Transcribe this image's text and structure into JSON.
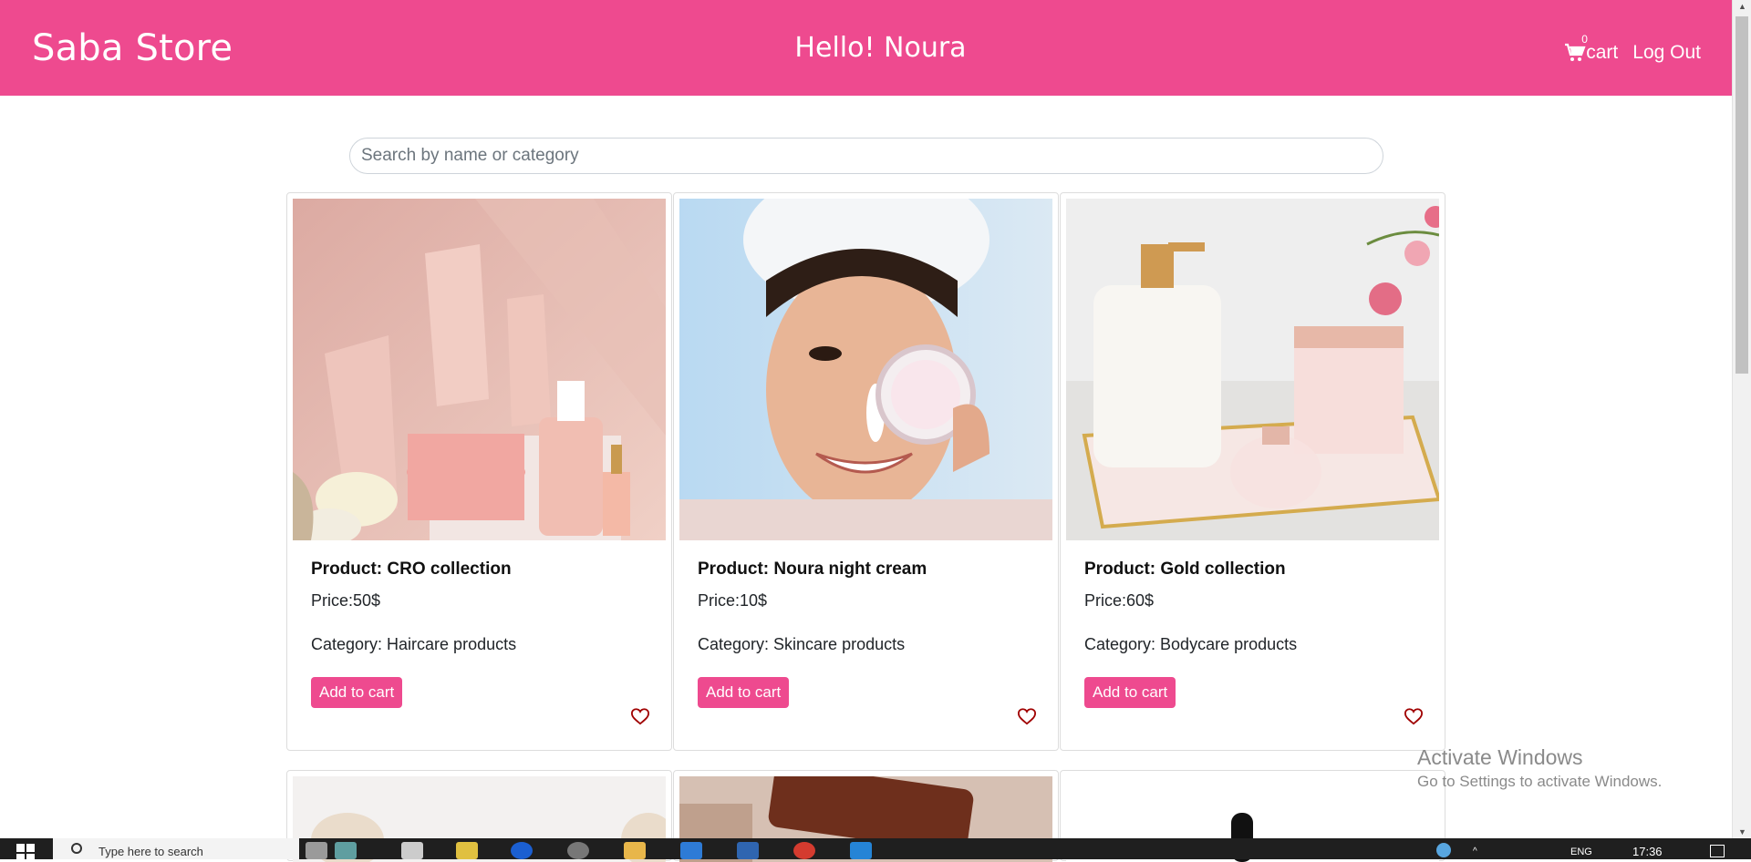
{
  "navbar": {
    "brand": "Saba Store",
    "greeting": "Hello! Noura",
    "cart_count": "0",
    "cart_label": "cart",
    "logout_label": "Log Out"
  },
  "search": {
    "placeholder": "Search by name or category"
  },
  "products": [
    {
      "title": "Product: CRO collection",
      "price": "Price:50$",
      "category": "Category: Haircare products",
      "button": "Add to cart"
    },
    {
      "title": "Product: Noura night cream",
      "price": "Price:10$",
      "category": "Category: Skincare products",
      "button": "Add to cart"
    },
    {
      "title": "Product: Gold collection",
      "price": "Price:60$",
      "category": "Category: Bodycare products",
      "button": "Add to cart"
    }
  ],
  "watermark": {
    "title": "Activate Windows",
    "subtitle": "Go to Settings to activate Windows."
  },
  "taskbar": {
    "search_text": "Type here to search",
    "time": "17:36",
    "lang": "ENG"
  },
  "colors": {
    "brand": "#ee4a8f",
    "heart": "#a00000"
  }
}
